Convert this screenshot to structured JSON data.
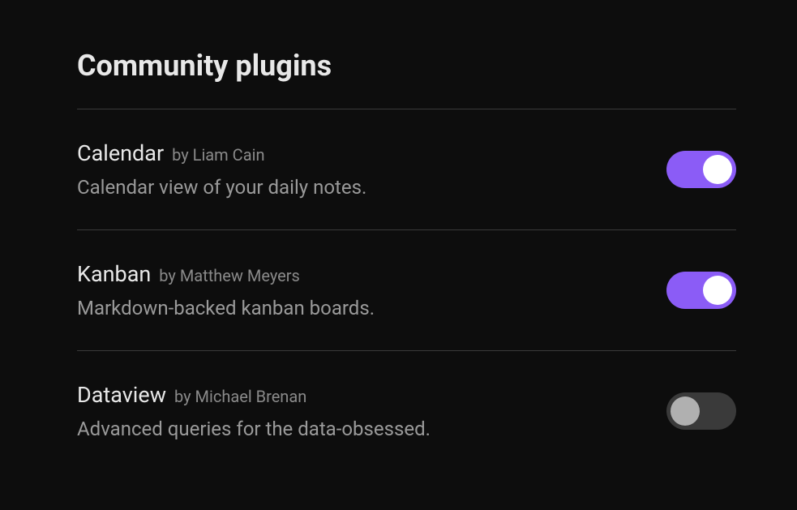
{
  "title": "Community plugins",
  "by_prefix": "by ",
  "plugins": [
    {
      "name": "Calendar",
      "author": "Liam Cain",
      "description": "Calendar view of your daily notes.",
      "enabled": true
    },
    {
      "name": "Kanban",
      "author": "Matthew Meyers",
      "description": "Markdown-backed kanban boards.",
      "enabled": true
    },
    {
      "name": "Dataview",
      "author": "Michael Brenan",
      "description": "Advanced queries for the data-obsessed.",
      "enabled": false
    }
  ]
}
